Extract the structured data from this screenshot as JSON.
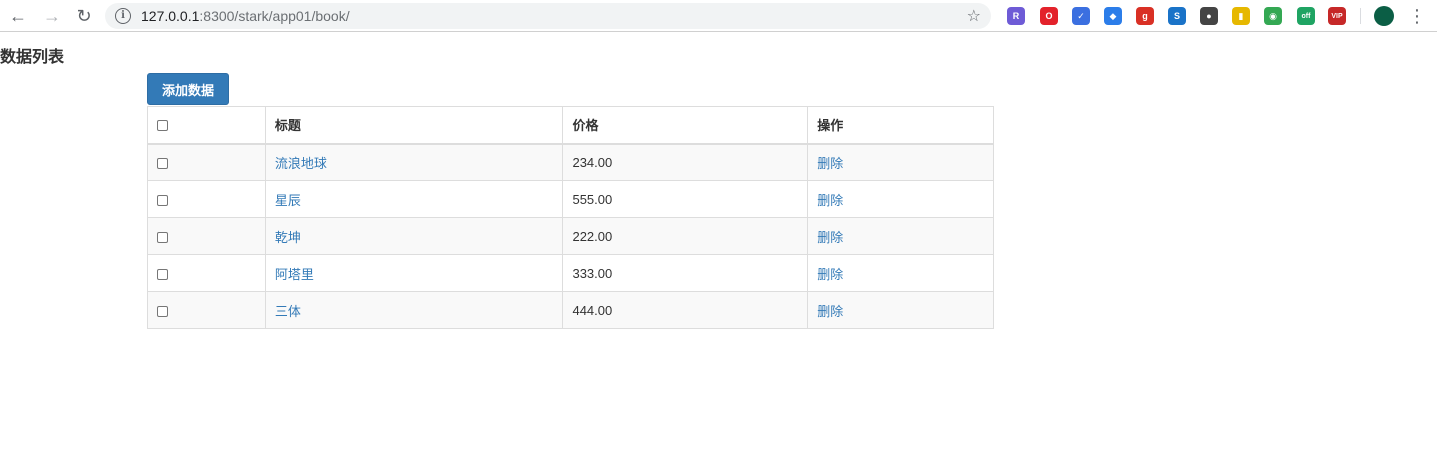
{
  "browser": {
    "url_host": "127.0.0.1",
    "url_rest": ":8300/stark/app01/book/",
    "extensions": [
      {
        "icon": "r-hex-icon",
        "color": "#6e5bd6",
        "glyph": "R"
      },
      {
        "icon": "opera-icon",
        "color": "#e3222b",
        "glyph": "O"
      },
      {
        "icon": "check-circle-icon",
        "color": "#3b6fe0",
        "glyph": "✓"
      },
      {
        "icon": "cap-icon",
        "color": "#2b7de9",
        "glyph": "◆"
      },
      {
        "icon": "g-icon",
        "color": "#d93025",
        "glyph": "g"
      },
      {
        "icon": "s-icon",
        "color": "#1a73c8",
        "glyph": "S"
      },
      {
        "icon": "dots-icon",
        "color": "#444444",
        "glyph": "●"
      },
      {
        "icon": "book-icon",
        "color": "#e6b800",
        "glyph": "▮"
      },
      {
        "icon": "chrome-icon",
        "color": "#34a853",
        "glyph": "◉"
      },
      {
        "icon": "off-icon",
        "color": "#1fa463",
        "glyph": "off"
      },
      {
        "icon": "vip-icon",
        "color": "#c62828",
        "glyph": "VIP"
      }
    ]
  },
  "page": {
    "title": "数据列表",
    "add_button": "添加数据"
  },
  "table": {
    "headers": [
      "",
      "标题",
      "价格",
      "操作"
    ],
    "rows": [
      {
        "title": "流浪地球",
        "price": "234.00",
        "action": "删除"
      },
      {
        "title": "星辰",
        "price": "555.00",
        "action": "删除"
      },
      {
        "title": "乾坤",
        "price": "222.00",
        "action": "删除"
      },
      {
        "title": "阿塔里",
        "price": "333.00",
        "action": "删除"
      },
      {
        "title": "三体",
        "price": "444.00",
        "action": "删除"
      }
    ]
  }
}
